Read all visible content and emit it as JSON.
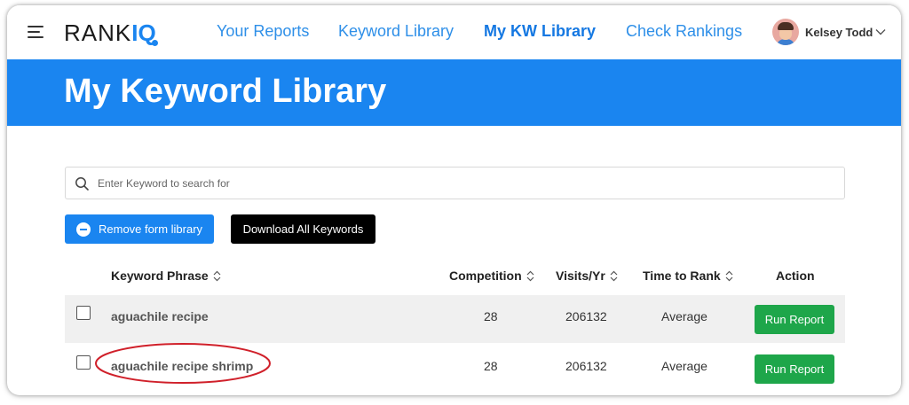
{
  "nav": {
    "logo_text": "RANKIQ",
    "links": [
      {
        "label": "Your Reports",
        "active": false
      },
      {
        "label": "Keyword Library",
        "active": false
      },
      {
        "label": "My KW Library",
        "active": true
      },
      {
        "label": "Check Rankings",
        "active": false
      }
    ],
    "user_name": "Kelsey Todd",
    "icons": {
      "menu": "hamburger-menu-icon",
      "user_menu": "chevron-down-icon"
    }
  },
  "banner": {
    "title": "My Keyword Library"
  },
  "search": {
    "placeholder": "Enter Keyword to search for",
    "value": ""
  },
  "actions": {
    "remove_label": "Remove form library",
    "download_label": "Download All Keywords"
  },
  "table": {
    "headers": {
      "keyword": "Keyword Phrase",
      "competition": "Competition",
      "visits": "Visits/Yr",
      "time_to_rank": "Time to Rank",
      "action": "Action"
    },
    "rows": [
      {
        "keyword": "aguachile recipe",
        "competition": "28",
        "visits": "206132",
        "time_to_rank": "Average",
        "action": "Run Report",
        "checked": false,
        "highlighted": false
      },
      {
        "keyword": "aguachile recipe shrimp",
        "competition": "28",
        "visits": "206132",
        "time_to_rank": "Average",
        "action": "Run Report",
        "checked": false,
        "highlighted": true
      }
    ]
  },
  "colors": {
    "brand_blue": "#1a85f0",
    "run_green": "#1ea64a",
    "annotation_red": "#d0202a"
  }
}
